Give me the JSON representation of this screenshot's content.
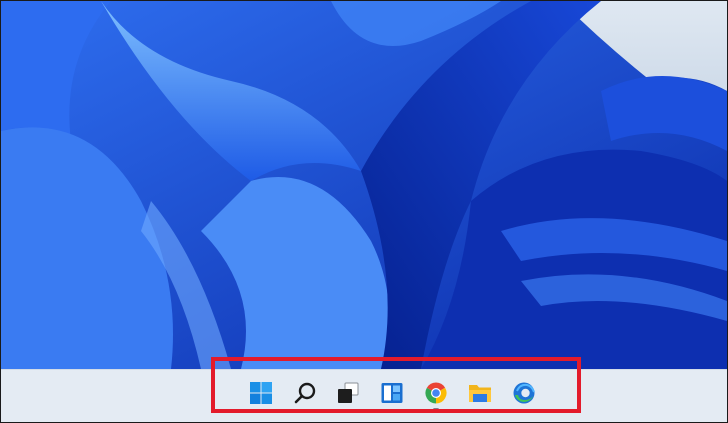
{
  "desktop": {
    "wallpaper": "windows-11-bloom-wallpaper",
    "colors": {
      "deep": "#0b2fb8",
      "mid": "#1f5fea",
      "light": "#6fb0ff",
      "sky": "#d9e3ef"
    }
  },
  "taskbar": {
    "background": "#e4ebf3",
    "highlight_color": "#e31b2b",
    "items": [
      {
        "icon": "windows-start-icon"
      },
      {
        "icon": "search-icon"
      },
      {
        "icon": "task-view-icon"
      },
      {
        "icon": "widgets-icon"
      },
      {
        "icon": "chrome-icon",
        "running": true
      },
      {
        "icon": "file-explorer-icon"
      },
      {
        "icon": "edge-icon"
      }
    ]
  }
}
